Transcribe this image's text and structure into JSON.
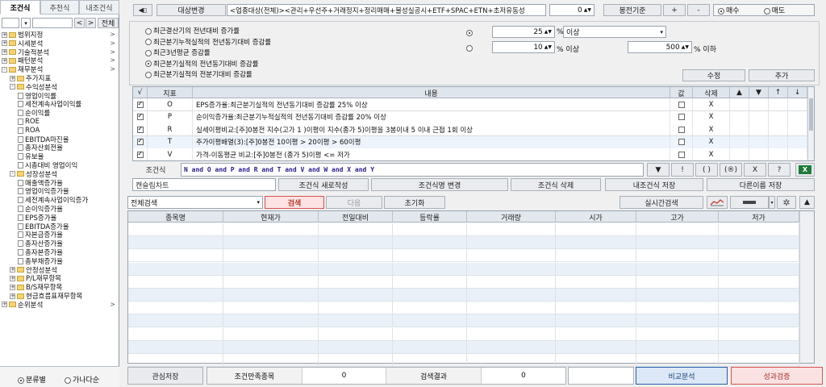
{
  "left_panel": {
    "tabs": [
      "조건식",
      "추천식",
      "내조건식"
    ],
    "search_button": "전체",
    "tree": [
      {
        "label": "범위지정",
        "level": 0,
        "type": "folder",
        "expand": "+",
        "arrow": true
      },
      {
        "label": "시세분석",
        "level": 0,
        "type": "folder",
        "expand": "+",
        "arrow": true
      },
      {
        "label": "기술적분석",
        "level": 0,
        "type": "folder",
        "expand": "+",
        "arrow": true
      },
      {
        "label": "패턴분석",
        "level": 0,
        "type": "folder",
        "expand": "+",
        "arrow": true
      },
      {
        "label": "재무분석",
        "level": 0,
        "type": "folder",
        "expand": "-",
        "arrow": true
      },
      {
        "label": "주가지표",
        "level": 1,
        "type": "folder",
        "expand": "+"
      },
      {
        "label": "수익성분석",
        "level": 1,
        "type": "folder",
        "expand": "-"
      },
      {
        "label": "영업이익률",
        "level": 2,
        "type": "doc"
      },
      {
        "label": "세전계속사업이익률",
        "level": 2,
        "type": "doc"
      },
      {
        "label": "순이익률",
        "level": 2,
        "type": "doc"
      },
      {
        "label": "ROE",
        "level": 2,
        "type": "doc"
      },
      {
        "label": "ROA",
        "level": 2,
        "type": "doc"
      },
      {
        "label": "EBITDA마진율",
        "level": 2,
        "type": "doc"
      },
      {
        "label": "총자산회전율",
        "level": 2,
        "type": "doc"
      },
      {
        "label": "유보율",
        "level": 2,
        "type": "doc"
      },
      {
        "label": "시총대비 영업이익",
        "level": 2,
        "type": "doc"
      },
      {
        "label": "성장성분석",
        "level": 1,
        "type": "folder",
        "expand": "-"
      },
      {
        "label": "매출액증가율",
        "level": 2,
        "type": "doc"
      },
      {
        "label": "영업이익증가율",
        "level": 2,
        "type": "doc"
      },
      {
        "label": "세전계속사업이익증가",
        "level": 2,
        "type": "doc"
      },
      {
        "label": "순이익증가율",
        "level": 2,
        "type": "doc"
      },
      {
        "label": "EPS증가율",
        "level": 2,
        "type": "doc"
      },
      {
        "label": "EBITDA증가율",
        "level": 2,
        "type": "doc"
      },
      {
        "label": "자본금증가율",
        "level": 2,
        "type": "doc"
      },
      {
        "label": "총자산증가율",
        "level": 2,
        "type": "doc"
      },
      {
        "label": "총자본증가율",
        "level": 2,
        "type": "doc"
      },
      {
        "label": "총부채증가율",
        "level": 2,
        "type": "doc"
      },
      {
        "label": "안정성분석",
        "level": 1,
        "type": "folder",
        "expand": "+"
      },
      {
        "label": "P/L재무항목",
        "level": 1,
        "type": "folder",
        "expand": "+"
      },
      {
        "label": "B/S재무항목",
        "level": 1,
        "type": "folder",
        "expand": "+"
      },
      {
        "label": "현금흐름표재무항목",
        "level": 1,
        "type": "folder",
        "expand": "+"
      },
      {
        "label": "순위분석",
        "level": 0,
        "type": "folder",
        "expand": "+",
        "arrow": true
      }
    ],
    "radio_category": "분류별",
    "radio_alpha": "가나다순"
  },
  "top": {
    "target_change_button": "대상변경",
    "target_text": "<업종대상(전체)><관리+우선주+거래정지+정리매매+불성실공시+ETF+SPAC+ETN+초저유동성",
    "spin_value": "0",
    "bong_basis_button": "봉전기준",
    "plus": "+",
    "minus": "-",
    "radio_buy": "매수",
    "radio_sell": "매도"
  },
  "options": {
    "items": [
      "최근결산기의 전년대비 증가률",
      "최근분기누적실적의 전년동기대비 증감률",
      "최근3년평균 증감률",
      "최근분기실적의 전년동기대비 증감률",
      "최근분기실적의 전분기대비 증감률"
    ],
    "selected_index": 3,
    "value1": "25",
    "unit1": "%",
    "combo1": "이상",
    "value2": "10",
    "unit2": "% 이상",
    "value3": "500",
    "unit3": "% 이하",
    "edit_button": "수정",
    "add_button": "추가"
  },
  "cond_table": {
    "headers": [
      "√",
      "지표",
      "내용",
      "값",
      "삭제",
      "▲",
      "▼",
      "↑",
      "↓"
    ],
    "rows": [
      {
        "checked": true,
        "code": "O",
        "content": "EPS증가율:최근분기실적의 전년동기대비 증감률 25% 이상",
        "del": "X"
      },
      {
        "checked": true,
        "code": "P",
        "content": "순이익증가율:최근분기누적실적의 전년동기대비 증감률 20% 이상",
        "del": "X"
      },
      {
        "checked": true,
        "code": "R",
        "content": "실세이평비교:[주]0봉전 지수(고가 1 )이평이 지수(종가 5)이평을 3봉이내 5 이내 근접 1회 이상",
        "del": "X"
      },
      {
        "checked": true,
        "code": "T",
        "content": "주가이평배열(3):[주]0봉전 10이평 > 20이평 > 60이평",
        "del": "X"
      },
      {
        "checked": true,
        "code": "V",
        "content": "가격-이동평균 비교:[주]0봉전 (종가 5)이평 <= 저가",
        "del": "X"
      }
    ]
  },
  "formula": {
    "label": "조건식",
    "text": "N and O and P and R and T and V and W and X and Y",
    "buttons": [
      "▼",
      "!",
      "( )",
      "(®)",
      "X",
      "?"
    ]
  },
  "actions": {
    "chart_name": "캔슬림차트",
    "new_button": "조건식 새로작성",
    "rename_button": "조건식명 변경",
    "delete_button": "조건식 삭제",
    "save_button": "내조건식 저장",
    "save_as_button": "다른이름 저장"
  },
  "search": {
    "scope": "전체검색",
    "search_button": "검색",
    "next_button": "다음",
    "reset_button": "초기화",
    "realtime_button": "실시간검색"
  },
  "results": {
    "headers": [
      "종목명",
      "현재가",
      "전일대비",
      "등락률",
      "거래량",
      "시가",
      "고가",
      "저가"
    ],
    "rows": []
  },
  "bottom": {
    "watch_save": "관심저장",
    "match_label": "조건만족종목",
    "match_count": "0",
    "result_label": "검색결과",
    "result_count": "0",
    "compare_button": "비교분석",
    "perf_button": "성과검증"
  },
  "colors": {
    "accent_red": "#d9534f",
    "accent_blue": "#2a5fa8"
  }
}
